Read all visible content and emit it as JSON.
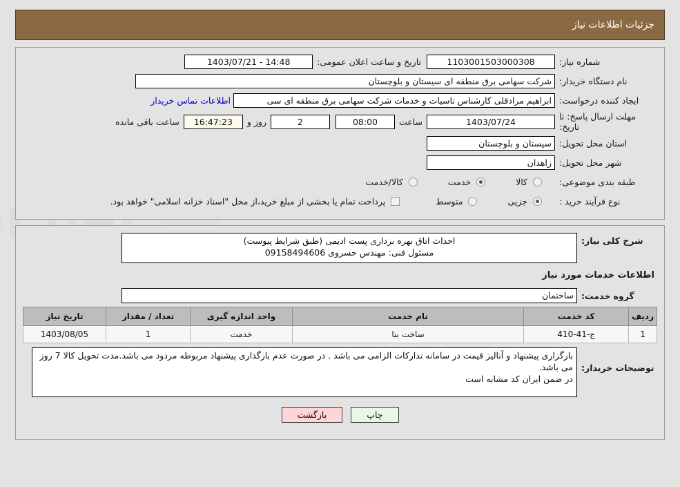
{
  "header": {
    "title": "جزئیات اطلاعات نیاز"
  },
  "colors": {
    "header_bg": "#8a6a42",
    "page_bg": "#e3e3e3",
    "link": "#0000cc",
    "timer_bg": "#fcfbee",
    "print_btn_bg": "#e9f7e6",
    "back_btn_bg": "#ffd5d5",
    "table_header_bg": "#bdbdbd"
  },
  "info": {
    "need_number_label": "شماره نیاز:",
    "need_number_value": "1103001503000308",
    "announce_datetime_label": "تاریخ و ساعت اعلان عمومی:",
    "announce_datetime_value": "14:48 - 1403/07/21",
    "buyer_org_label": "نام دستگاه خریدار:",
    "buyer_org_value": "شرکت سهامی برق منطقه ای سیستان و بلوچستان",
    "requester_label": "ایجاد کننده درخواست:",
    "requester_value": "ابراهیم مرادقلی کارشناس تاسیات و خدمات شرکت سهامی برق منطقه ای سی",
    "buyer_contact_link": "اطلاعات تماس خریدار",
    "deadline_label": "مهلت ارسال پاسخ: تا تاریخ:",
    "deadline_date": "1403/07/24",
    "hour_label": "ساعت",
    "deadline_time": "08:00",
    "days_remaining": "2",
    "days_word": "روز و",
    "countdown": "16:47:23",
    "remaining_suffix": "ساعت باقی مانده",
    "province_label": "استان محل تحویل:",
    "province_value": "سیستان و بلوچستان",
    "city_label": "شهر محل تحویل:",
    "city_value": "زاهدان",
    "category_label": "طبقه بندی موضوعی:",
    "category_options": [
      {
        "label": "کالا",
        "selected": false
      },
      {
        "label": "خدمت",
        "selected": true
      },
      {
        "label": "کالا/خدمت",
        "selected": false
      }
    ],
    "process_label": "نوع فرآیند خرید :",
    "process_options": [
      {
        "label": "جزیی",
        "selected": true
      },
      {
        "label": "متوسط",
        "selected": false
      }
    ],
    "treasury_checkbox_checked": false,
    "treasury_text": "پرداخت تمام یا بخشی از مبلغ خرید،از محل \"اسناد خزانه اسلامی\" خواهد بود."
  },
  "details": {
    "general_desc_label": "شرح کلی نیاز:",
    "general_desc_value": "احداث اتاق بهره برداری پست ادیمی (طبق شرایط پیوست)\nمسئول فنی: مهندس خسروی 09158494606",
    "services_section_title": "اطلاعات خدمات مورد نیاز",
    "service_group_label": "گروه خدمت:",
    "service_group_value": "ساختمان",
    "table": {
      "columns": [
        "ردیف",
        "کد خدمت",
        "نام خدمت",
        "واحد اندازه گیری",
        "تعداد / مقدار",
        "تاریخ نیاز"
      ],
      "rows": [
        [
          "1",
          "ج-41-410",
          "ساخت بنا",
          "خدمت",
          "1",
          "1403/08/05"
        ]
      ]
    },
    "buyer_notes_label": "توضیحات خریدار:",
    "buyer_notes_value": "بارگزاری پیشنهاد و آنالیز قیمت در سامانه تدارکات الزامی می باشد . در صورت عدم بارگذاری پیشنهاد مربوطه مردود می باشد.مدت تحویل کالا 7 روز می باشد.\nدر ضمن ایران کد مشابه است"
  },
  "buttons": {
    "print": "چاپ",
    "back": "بازگشت"
  },
  "watermark": {
    "text": "AriaTender.net"
  }
}
